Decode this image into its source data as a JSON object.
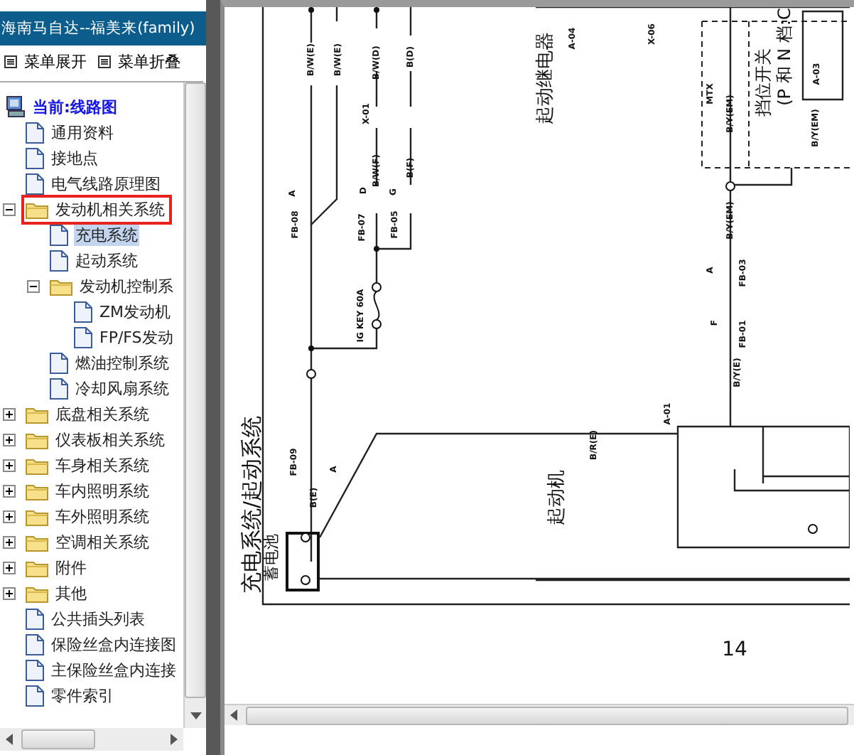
{
  "window": {
    "title": "海南马自达--福美来(family)"
  },
  "menu": [
    {
      "label": "菜单展开"
    },
    {
      "label": "菜单折叠"
    }
  ],
  "tree": [
    {
      "label": "当前:线路图",
      "kind": "root",
      "selected": false,
      "children": [
        {
          "label": "通用资料",
          "kind": "doc",
          "selected": false
        },
        {
          "label": "接地点",
          "kind": "doc",
          "selected": false
        },
        {
          "label": "电气线路原理图",
          "kind": "doc",
          "selected": false
        },
        {
          "label": "发动机相关系统",
          "kind": "folder",
          "expanded": true,
          "highlighted": true,
          "selected": false,
          "children": [
            {
              "label": "充电系统",
              "kind": "doc",
              "selected": true
            },
            {
              "label": "起动系统",
              "kind": "doc",
              "selected": false
            },
            {
              "label": "发动机控制系",
              "kind": "folder",
              "expanded": true,
              "selected": false,
              "children": [
                {
                  "label": "ZM发动机",
                  "kind": "doc",
                  "selected": false
                },
                {
                  "label": "FP/FS发动",
                  "kind": "doc",
                  "selected": false
                }
              ]
            },
            {
              "label": "燃油控制系统",
              "kind": "doc",
              "selected": false
            },
            {
              "label": "冷却风扇系统",
              "kind": "doc",
              "selected": false
            }
          ]
        },
        {
          "label": "底盘相关系统",
          "kind": "folder",
          "expanded": false,
          "selected": false
        },
        {
          "label": "仪表板相关系统",
          "kind": "folder",
          "expanded": false,
          "selected": false
        },
        {
          "label": "车身相关系统",
          "kind": "folder",
          "expanded": false,
          "selected": false
        },
        {
          "label": "车内照明系统",
          "kind": "folder",
          "expanded": false,
          "selected": false
        },
        {
          "label": "车外照明系统",
          "kind": "folder",
          "expanded": false,
          "selected": false
        },
        {
          "label": "空调相关系统",
          "kind": "folder",
          "expanded": false,
          "selected": false
        },
        {
          "label": "附件",
          "kind": "folder",
          "expanded": false,
          "selected": false
        },
        {
          "label": "其他",
          "kind": "folder",
          "expanded": false,
          "selected": false
        },
        {
          "label": "公共插头列表",
          "kind": "doc",
          "selected": false
        },
        {
          "label": "保险丝盒内连接图",
          "kind": "doc",
          "selected": false
        },
        {
          "label": "主保险丝盒内连接",
          "kind": "doc",
          "selected": false
        },
        {
          "label": "零件索引",
          "kind": "doc",
          "selected": false
        }
      ]
    }
  ],
  "diagram": {
    "labels": [
      {
        "text": "充电系统/起动系统",
        "kind": "title"
      },
      {
        "text": "蓄电池",
        "kind": "component"
      },
      {
        "text": "起动机",
        "kind": "component"
      },
      {
        "text": "起动继电器",
        "kind": "component"
      },
      {
        "text": "挡位开关",
        "kind": "component"
      },
      {
        "text": "(P 和 N 档:C",
        "kind": "component"
      },
      {
        "text": "14",
        "kind": "page-number"
      },
      {
        "text": "B/W(E)",
        "kind": "wire"
      },
      {
        "text": "B/W(E)",
        "kind": "wire"
      },
      {
        "text": "B/W(D)",
        "kind": "wire"
      },
      {
        "text": "B(D)",
        "kind": "wire"
      },
      {
        "text": "X-01",
        "kind": "connector"
      },
      {
        "text": "B/W(F)",
        "kind": "wire"
      },
      {
        "text": "B(F)",
        "kind": "wire"
      },
      {
        "text": "FB-08",
        "kind": "wire"
      },
      {
        "text": "FB-07",
        "kind": "wire"
      },
      {
        "text": "FB-05",
        "kind": "wire"
      },
      {
        "text": "IG KEY 60A",
        "kind": "wire"
      },
      {
        "text": "FB-09",
        "kind": "wire"
      },
      {
        "text": "B(E)",
        "kind": "wire"
      },
      {
        "text": "B/R(E)",
        "kind": "wire"
      },
      {
        "text": "A-01",
        "kind": "wire"
      },
      {
        "text": "A-04",
        "kind": "wire"
      },
      {
        "text": "X-06",
        "kind": "connector"
      },
      {
        "text": "MTX",
        "kind": "wire"
      },
      {
        "text": "B/Y(EM)",
        "kind": "wire"
      },
      {
        "text": "B/Y(EM)",
        "kind": "wire"
      },
      {
        "text": "FB-03",
        "kind": "wire"
      },
      {
        "text": "FB-01",
        "kind": "wire"
      },
      {
        "text": "B/Y(E)",
        "kind": "wire"
      },
      {
        "text": "A-03",
        "kind": "wire"
      },
      {
        "text": "B/Y(EM)",
        "kind": "wire"
      },
      {
        "text": "A",
        "kind": "circle"
      },
      {
        "text": "D",
        "kind": "circle"
      },
      {
        "text": "G",
        "kind": "circle"
      },
      {
        "text": "A",
        "kind": "circle"
      },
      {
        "text": "F",
        "kind": "circle"
      },
      {
        "text": "A",
        "kind": "circle"
      }
    ]
  }
}
